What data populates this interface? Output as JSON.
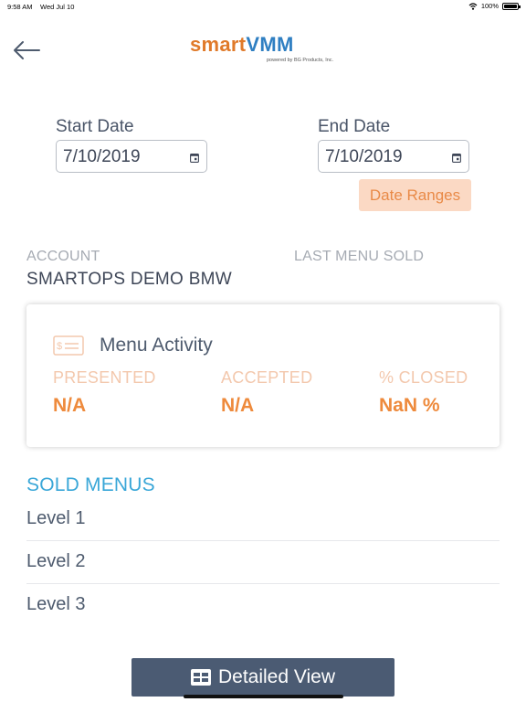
{
  "status_bar": {
    "time": "9:58 AM",
    "date": "Wed Jul 10",
    "battery": "100%"
  },
  "header": {
    "logo": {
      "smart": "smart",
      "vmm": "VMM",
      "tagline": "powered by BG Products, Inc."
    },
    "icons": {
      "back": "arrow-left-icon"
    }
  },
  "filters": {
    "start_label": "Start Date",
    "start_value": "7/10/2019",
    "end_label": "End Date",
    "end_value": "7/10/2019",
    "ranges_label": "Date Ranges"
  },
  "account": {
    "label": "ACCOUNT",
    "name": "SMARTOPS DEMO BMW",
    "last_menu_label": "LAST MENU SOLD"
  },
  "menu_activity": {
    "title": "Menu Activity",
    "stats": [
      {
        "label": "PRESENTED",
        "value": "N/A"
      },
      {
        "label": "ACCEPTED",
        "value": "N/A"
      },
      {
        "label": "% CLOSED",
        "value": "NaN %"
      }
    ]
  },
  "sold_menus": {
    "title": "SOLD MENUS",
    "levels": [
      "Level 1",
      "Level 2",
      "Level 3"
    ]
  },
  "footer": {
    "detailed_view_label": "Detailed View"
  },
  "colors": {
    "accent_orange": "#ee8a3c",
    "accent_blue": "#3aa7d8",
    "button_dark": "#4b5b73",
    "range_bg": "#fbd9c4"
  }
}
